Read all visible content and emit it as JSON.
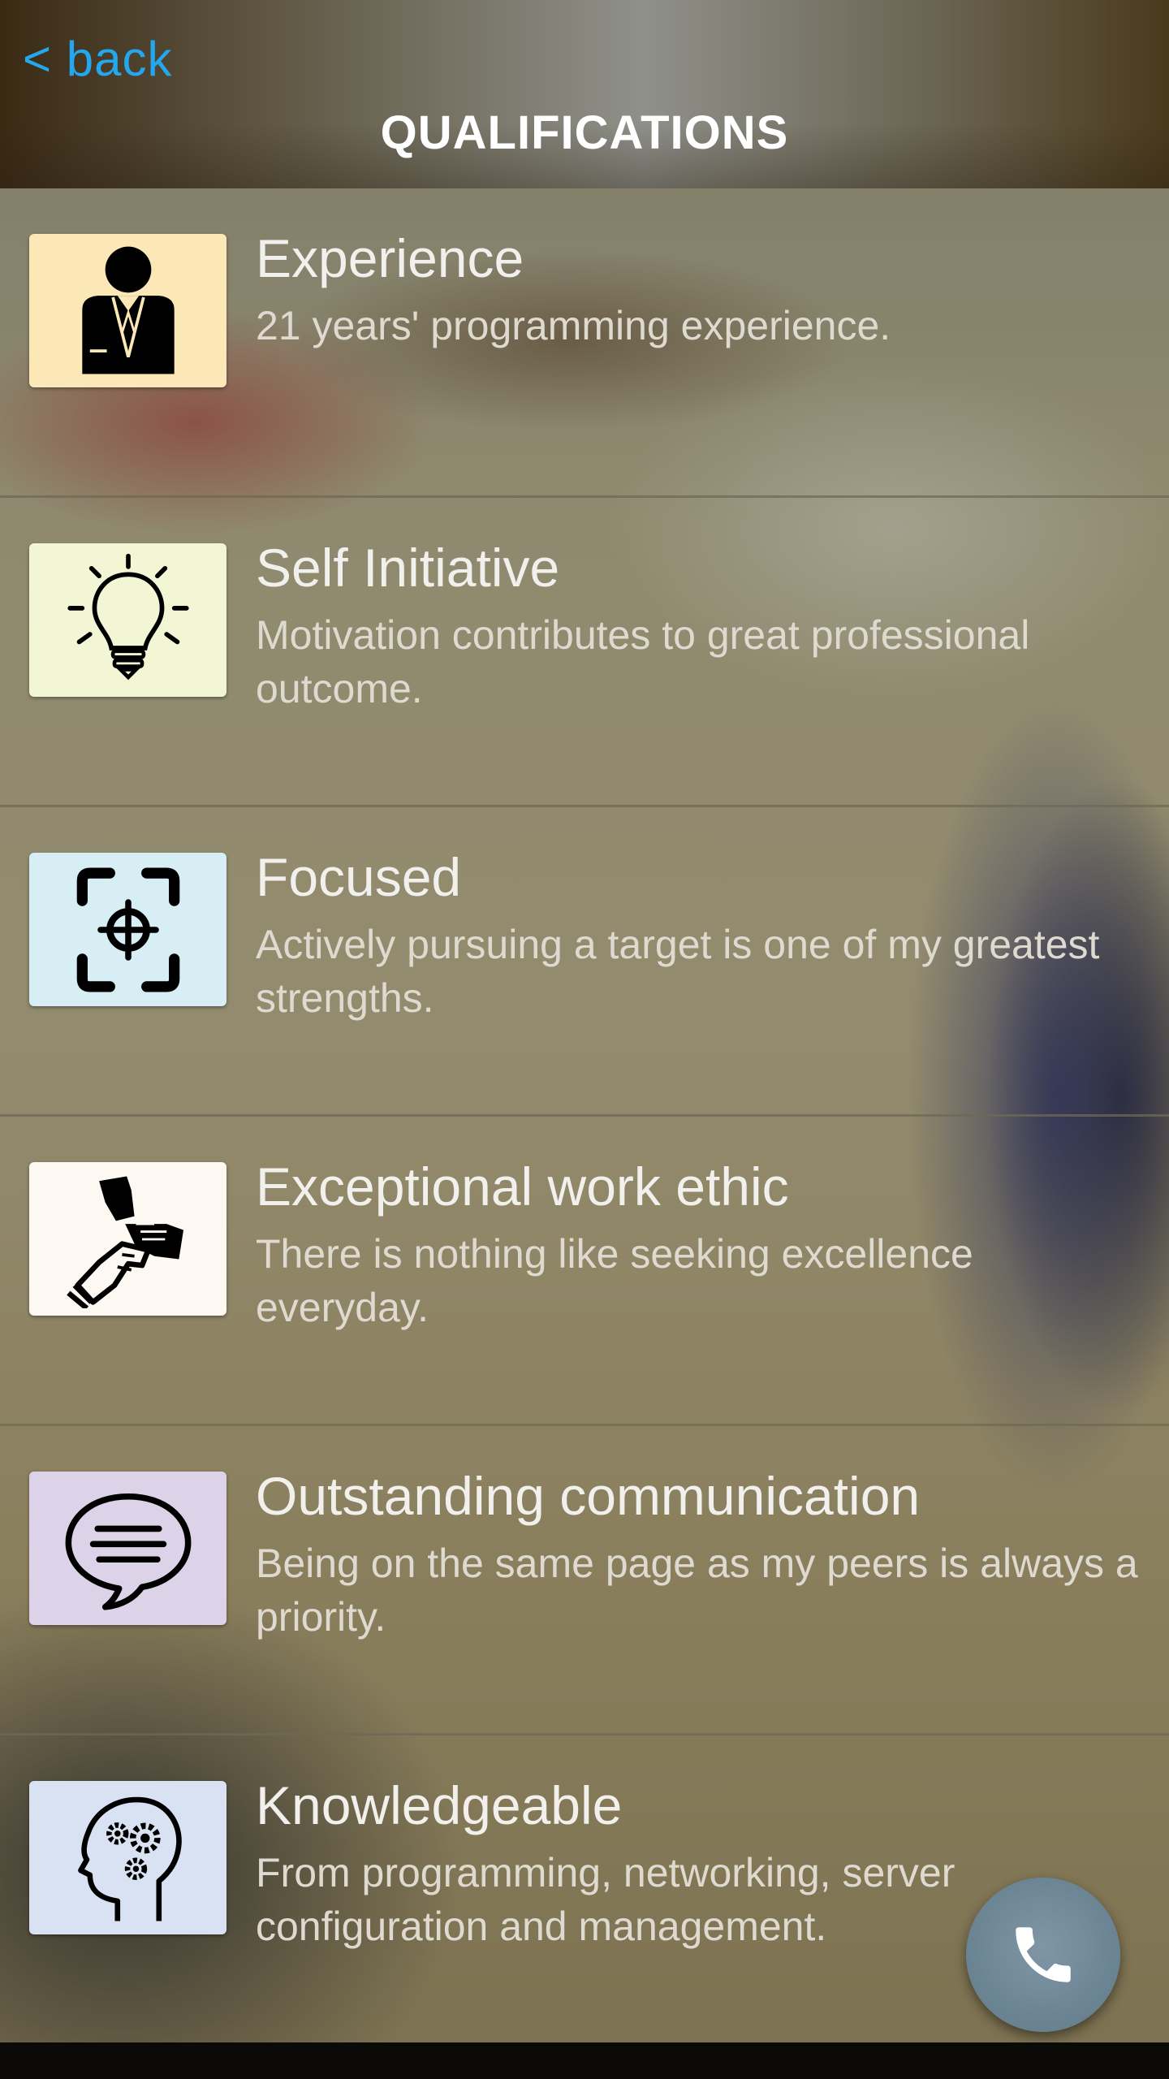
{
  "header": {
    "back_label": "< back",
    "title": "QUALIFICATIONS"
  },
  "qualifications": [
    {
      "title": "Experience",
      "description": "21 years' programming experience.",
      "icon": "businessman-icon",
      "icon_bg": "#fce8b6"
    },
    {
      "title": "Self Initiative",
      "description": "Motivation contributes to great professional outcome.",
      "icon": "lightbulb-icon",
      "icon_bg": "#f2f6d4"
    },
    {
      "title": "Focused",
      "description": "Actively pursuing a target is one of my greatest strengths.",
      "icon": "target-icon",
      "icon_bg": "#d7eef5"
    },
    {
      "title": "Exceptional work ethic",
      "description": "There is nothing like seeking excellence everyday.",
      "icon": "teamwork-hands-icon",
      "icon_bg": "#fdf8f1"
    },
    {
      "title": "Outstanding communication",
      "description": "Being on the same page as my peers is always a priority.",
      "icon": "speech-bubble-icon",
      "icon_bg": "#ddd3e8"
    },
    {
      "title": "Knowledgeable",
      "description": "From programming, networking, server configuration and management.",
      "icon": "head-gears-icon",
      "icon_bg": "#d9e2f2"
    }
  ],
  "fab": {
    "icon": "phone-icon"
  },
  "colors": {
    "accent": "#23a7ee",
    "title_text": "#f2f0ec",
    "desc_text": "#dedad0"
  }
}
